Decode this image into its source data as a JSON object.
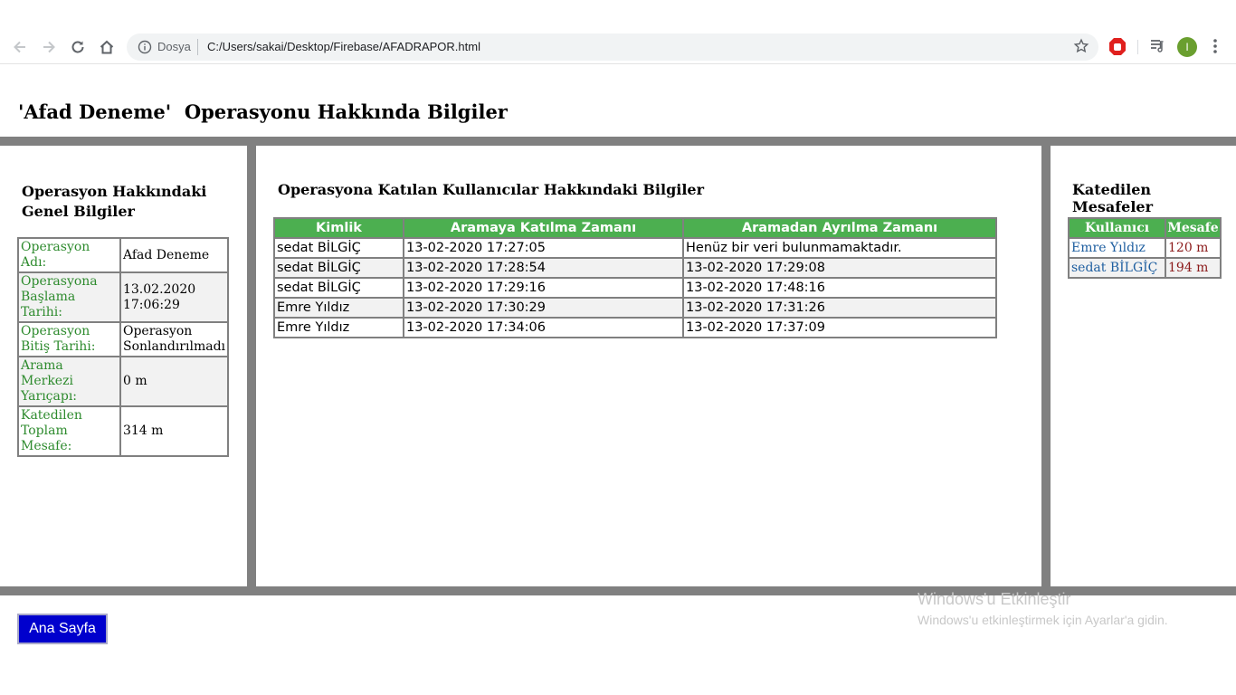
{
  "browser": {
    "url_prefix": "Dosya",
    "url": "C:/Users/sakai/Desktop/Firebase/AFADRAPOR.html",
    "avatar_letter": "I"
  },
  "page": {
    "title": "'Afad Deneme'  Operasyonu Hakkında Bilgiler"
  },
  "left": {
    "heading": "Operasyon Hakkındaki Genel Bilgiler",
    "rows": [
      {
        "label": "Operasyon Adı:",
        "value": "Afad Deneme"
      },
      {
        "label": "Operasyona Başlama Tarihi:",
        "value": "13.02.2020 17:06:29"
      },
      {
        "label": "Operasyon Bitiş Tarihi:",
        "value": "Operasyon Sonlandırılmadı"
      },
      {
        "label": "Arama Merkezi Yarıçapı:",
        "value": "0 m"
      },
      {
        "label": "Katedilen Toplam Mesafe:",
        "value": "314 m"
      }
    ]
  },
  "middle": {
    "heading": "Operasyona Katılan Kullanıcılar Hakkındaki Bilgiler",
    "columns": [
      "Kimlik",
      "Aramaya Katılma Zamanı",
      "Aramadan Ayrılma Zamanı"
    ],
    "rows": [
      [
        "sedat BİLGİÇ",
        "13-02-2020 17:27:05",
        "Henüz bir veri bulunmamaktadır."
      ],
      [
        "sedat BİLGİÇ",
        "13-02-2020 17:28:54",
        "13-02-2020 17:29:08"
      ],
      [
        "sedat BİLGİÇ",
        "13-02-2020 17:29:16",
        "13-02-2020 17:48:16"
      ],
      [
        "Emre Yıldız",
        "13-02-2020 17:30:29",
        "13-02-2020 17:31:26"
      ],
      [
        "Emre Yıldız",
        "13-02-2020 17:34:06",
        "13-02-2020 17:37:09"
      ]
    ]
  },
  "right": {
    "heading": "Katedilen Mesafeler",
    "columns": [
      "Kullanıcı",
      "Mesafe"
    ],
    "rows": [
      [
        "Emre Yıldız",
        "120 m"
      ],
      [
        "sedat BİLGİÇ",
        "194 m"
      ]
    ]
  },
  "footer": {
    "home_button": "Ana Sayfa"
  },
  "watermark": {
    "title": "Windows'u Etkinleştir",
    "subtitle": "Windows'u etkinleştirmek için Ayarlar'a gidin."
  },
  "colors": {
    "header_green": "#4caf50",
    "label_green": "#2e8b2e",
    "bar_gray": "#808080",
    "button_blue": "#0000cd"
  }
}
